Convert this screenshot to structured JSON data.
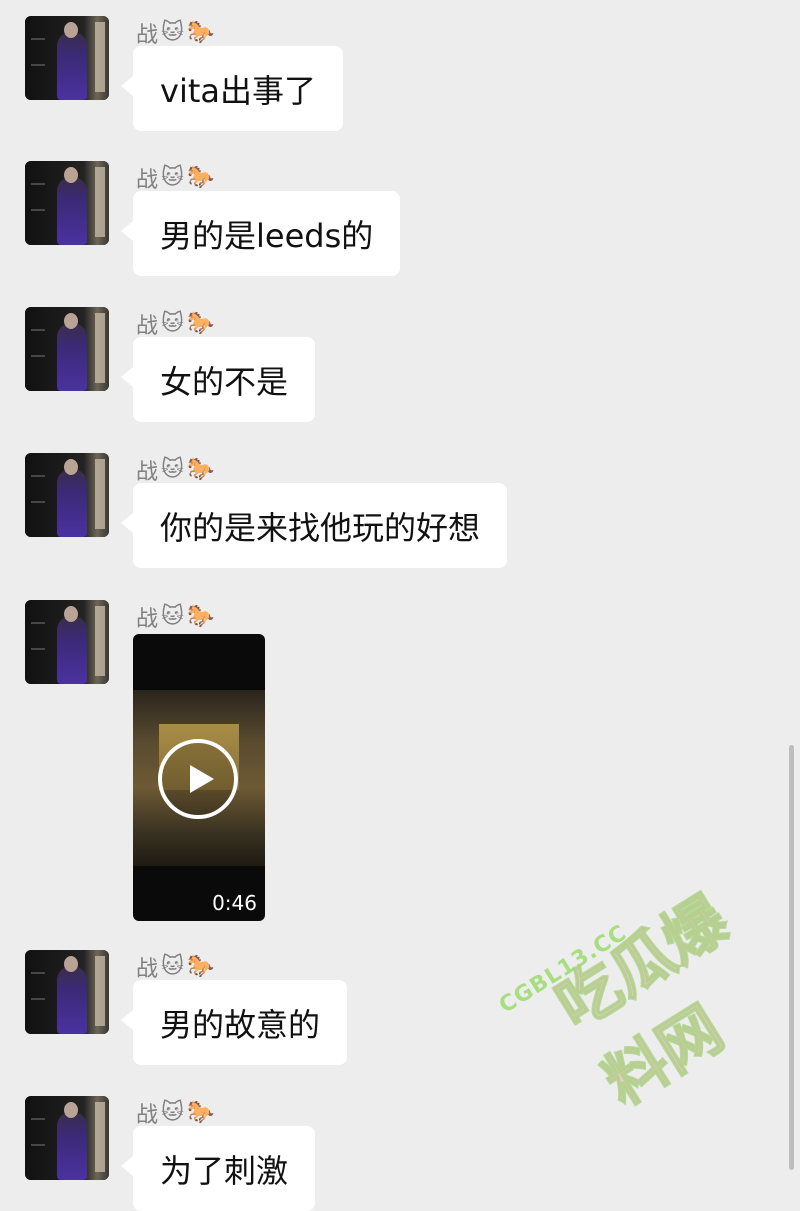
{
  "contact": {
    "name": "战",
    "name_emojis": [
      "🐱",
      "🐎"
    ]
  },
  "messages": [
    {
      "type": "text",
      "text": "vita出事了"
    },
    {
      "type": "text",
      "text": "男的是leeds的"
    },
    {
      "type": "text",
      "text": "女的不是"
    },
    {
      "type": "text",
      "text": "你的是来找他玩的好想"
    },
    {
      "type": "video",
      "duration": "0:46",
      "icon": "play-icon"
    },
    {
      "type": "text",
      "text": "男的故意的"
    },
    {
      "type": "text",
      "text": "为了刺激"
    }
  ],
  "watermark": {
    "url": "CGBL13.CC",
    "brand": "吃瓜爆料网"
  },
  "colors": {
    "background": "#ededed",
    "bubble": "#ffffff",
    "name": "#808080"
  }
}
